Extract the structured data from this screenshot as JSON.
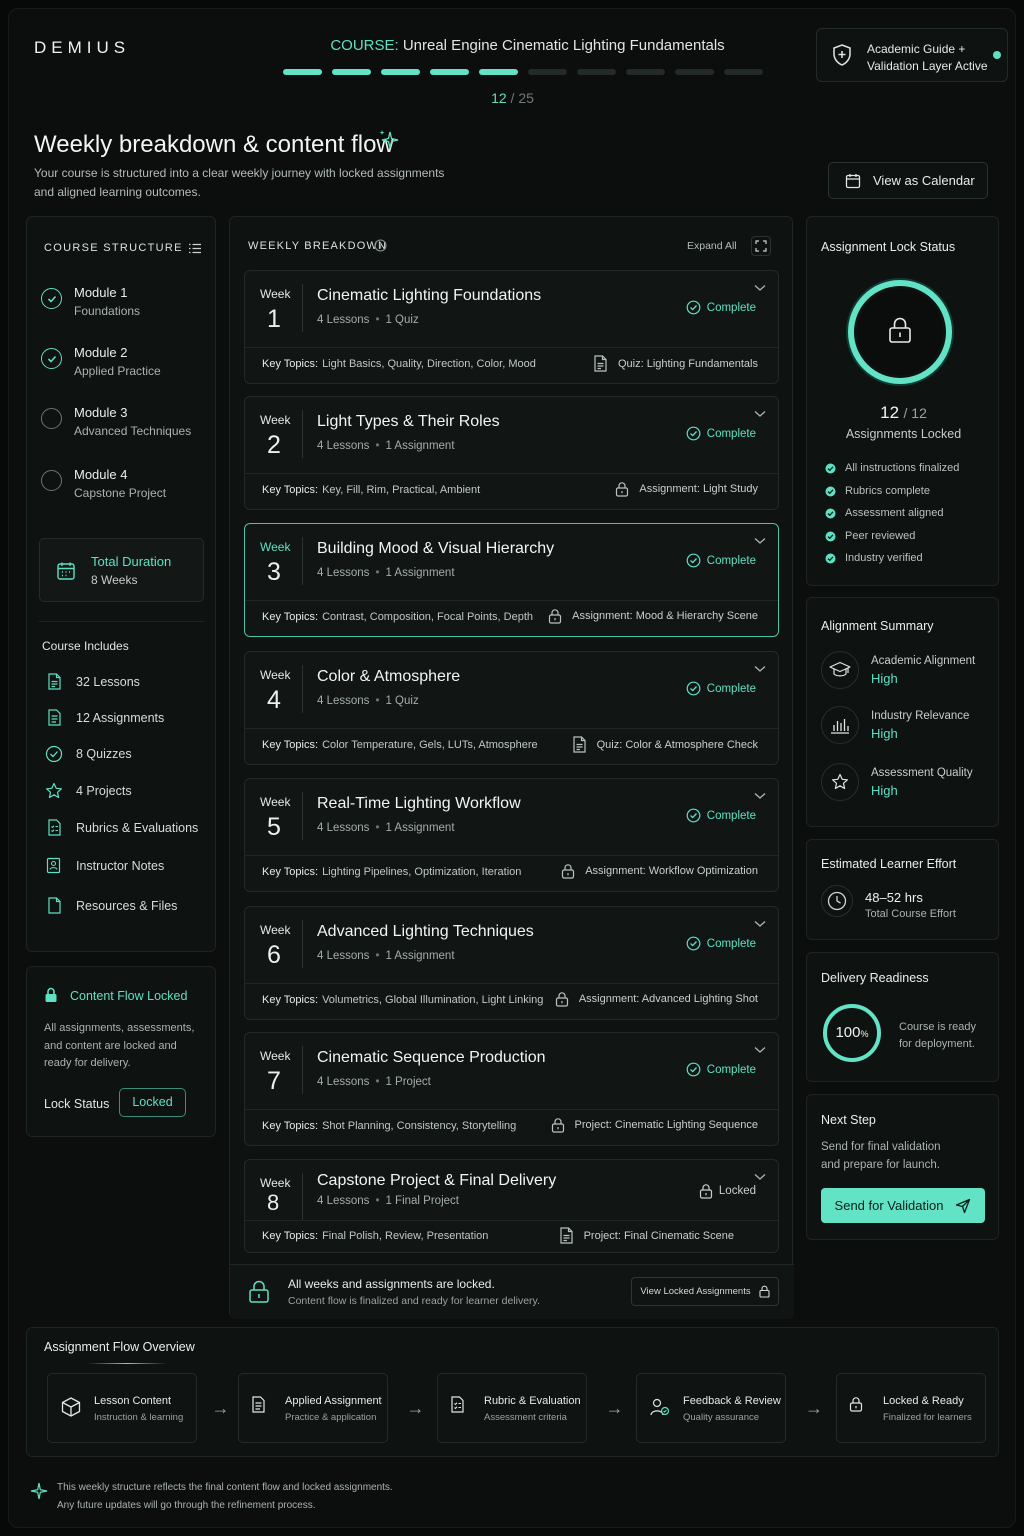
{
  "brand": "DEMIUS",
  "course": {
    "prefix": "COURSE:",
    "name": "Unreal Engine Cinematic Lighting Fundamentals"
  },
  "progress": {
    "current": "12",
    "total": "/ 25",
    "filled_segments": 5,
    "total_segments": 10
  },
  "guide": {
    "line1": "Academic Guide +",
    "line2": "Validation Layer Active",
    "icon": "shield-icon"
  },
  "page": {
    "title": "Weekly breakdown & content flow",
    "subtitle_line1": "Your course is structured into a clear weekly journey with locked assignments",
    "subtitle_line2": "and aligned learning outcomes.",
    "calendar_button": "View as Calendar"
  },
  "structure": {
    "title": "COURSE STRUCTURE",
    "modules": [
      {
        "name": "Module 1",
        "sub": "Foundations",
        "done": true
      },
      {
        "name": "Module 2",
        "sub": "Applied Practice",
        "done": true
      },
      {
        "name": "Module 3",
        "sub": "Advanced Techniques",
        "done": false
      },
      {
        "name": "Module 4",
        "sub": "Capstone Project",
        "done": false
      }
    ],
    "duration_label": "Total Duration",
    "duration_value": "8 Weeks",
    "includes_title": "Course Includes",
    "includes": [
      {
        "label": "32 Lessons",
        "icon": "document-icon"
      },
      {
        "label": "12 Assignments",
        "icon": "assignment-icon"
      },
      {
        "label": "8 Quizzes",
        "icon": "check-circle-icon"
      },
      {
        "label": "4 Projects",
        "icon": "star-icon"
      },
      {
        "label": "Rubrics & Evaluations",
        "icon": "rubric-icon"
      },
      {
        "label": "Instructor Notes",
        "icon": "notes-icon"
      },
      {
        "label": "Resources & Files",
        "icon": "file-icon"
      }
    ]
  },
  "content_lock": {
    "title": "Content Flow Locked",
    "desc_line1": "All assignments, assessments,",
    "desc_line2": "and content are locked and",
    "desc_line3": "ready for delivery.",
    "status_label": "Lock Status",
    "status_value": "Locked"
  },
  "breakdown": {
    "title": "WEEKLY BREAKDOWN",
    "expand_label": "Expand All",
    "week_word": "Week",
    "topics_label": "Key Topics:",
    "weeks": [
      {
        "num": "1",
        "title": "Cinematic Lighting Foundations",
        "lessons": "4 Lessons",
        "extra": "1 Quiz",
        "status": "Complete",
        "topics": "Light Basics, Quality, Direction, Color, Mood",
        "assignment": "Quiz: Lighting Fundamentals",
        "assign_icon": "document-icon"
      },
      {
        "num": "2",
        "title": "Light Types & Their Roles",
        "lessons": "4 Lessons",
        "extra": "1 Assignment",
        "status": "Complete",
        "topics": "Key, Fill, Rim, Practical, Ambient",
        "assignment": "Assignment: Light Study",
        "assign_icon": "lock-icon"
      },
      {
        "num": "3",
        "title": "Building Mood & Visual Hierarchy",
        "lessons": "4 Lessons",
        "extra": "1 Assignment",
        "status": "Complete",
        "topics": "Contrast, Composition, Focal Points, Depth",
        "assignment": "Assignment: Mood & Hierarchy Scene",
        "assign_icon": "lock-icon"
      },
      {
        "num": "4",
        "title": "Color & Atmosphere",
        "lessons": "4 Lessons",
        "extra": "1 Quiz",
        "status": "Complete",
        "topics": "Color Temperature, Gels, LUTs, Atmosphere",
        "assignment": "Quiz: Color & Atmosphere Check",
        "assign_icon": "document-icon"
      },
      {
        "num": "5",
        "title": "Real-Time Lighting Workflow",
        "lessons": "4 Lessons",
        "extra": "1 Assignment",
        "status": "Complete",
        "topics": "Lighting Pipelines, Optimization, Iteration",
        "assignment": "Assignment: Workflow Optimization",
        "assign_icon": "lock-icon"
      },
      {
        "num": "6",
        "title": "Advanced Lighting Techniques",
        "lessons": "4 Lessons",
        "extra": "1 Assignment",
        "status": "Complete",
        "topics": "Volumetrics, Global Illumination, Light Linking",
        "assignment": "Assignment: Advanced Lighting Shot",
        "assign_icon": "lock-icon"
      },
      {
        "num": "7",
        "title": "Cinematic Sequence Production",
        "lessons": "4 Lessons",
        "extra": "1 Project",
        "status": "Complete",
        "topics": "Shot Planning, Consistency, Storytelling",
        "assignment": "Project: Cinematic Lighting Sequence",
        "assign_icon": "lock-icon"
      },
      {
        "num": "8",
        "title": "Capstone Project & Final Delivery",
        "lessons": "4 Lessons",
        "extra": "1 Final Project",
        "status": "Locked",
        "topics": "Final Polish, Review, Presentation",
        "assignment": "Project: Final Cinematic Scene",
        "assign_icon": "document-icon"
      }
    ],
    "footer_title": "All weeks and assignments are locked.",
    "footer_sub": "Content flow is finalized and ready for learner delivery.",
    "footer_button": "View Locked Assignments"
  },
  "lock_status": {
    "title": "Assignment Lock Status",
    "count": "12",
    "total": "/ 12",
    "label": "Assignments Locked",
    "checks": [
      "All instructions finalized",
      "Rubrics complete",
      "Assessment aligned",
      "Peer reviewed",
      "Industry verified"
    ]
  },
  "alignment": {
    "title": "Alignment Summary",
    "items": [
      {
        "label": "Academic Alignment",
        "value": "High",
        "icon": "graduation-cap-icon"
      },
      {
        "label": "Industry Relevance",
        "value": "High",
        "icon": "bar-chart-icon"
      },
      {
        "label": "Assessment Quality",
        "value": "High",
        "icon": "star-icon"
      }
    ]
  },
  "effort": {
    "title": "Estimated Learner Effort",
    "value": "48–52 hrs",
    "label": "Total Course Effort"
  },
  "readiness": {
    "title": "Delivery Readiness",
    "percent": "100",
    "percent_sign": "%",
    "fill": 1.0,
    "line1": "Course is ready",
    "line2": "for deployment."
  },
  "next_step": {
    "title": "Next Step",
    "line1": "Send for final validation",
    "line2": "and prepare for launch.",
    "button": "Send for Validation"
  },
  "flow": {
    "title": "Assignment Flow Overview",
    "steps": [
      {
        "title": "Lesson Content",
        "sub": "Instruction & learning",
        "icon": "cube-icon"
      },
      {
        "title": "Applied Assignment",
        "sub": "Practice & application",
        "icon": "assignment-icon"
      },
      {
        "title": "Rubric & Evaluation",
        "sub": "Assessment criteria",
        "icon": "rubric-icon"
      },
      {
        "title": "Feedback & Review",
        "sub": "Quality assurance",
        "icon": "feedback-icon"
      },
      {
        "title": "Locked & Ready",
        "sub": "Finalized for learners",
        "icon": "lock-icon"
      }
    ],
    "arrow": "→"
  },
  "footnote": {
    "line1": "This weekly structure reflects the final content flow and locked assignments.",
    "line2": "Any future updates will go through the refinement process."
  },
  "colors": {
    "accent": "#5fe0c2",
    "background": "#0b0e0d",
    "panel": "#0e1211"
  }
}
